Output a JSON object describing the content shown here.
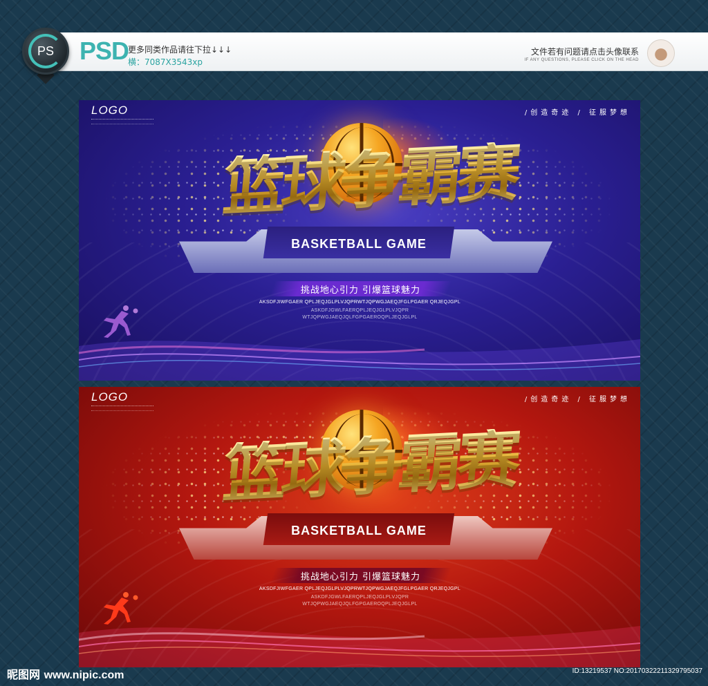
{
  "header": {
    "badge_label": "PS",
    "format_label": "PSD",
    "more_text": "更多同类作品请往下拉↓↓↓",
    "dimension_text": "横：7087X3543xp",
    "contact_text": "文件若有问题请点击头像联系",
    "contact_text_en": "IF ANY QUESTIONS, PLEASE CLICK ON THE HEAD"
  },
  "posters": [
    {
      "theme": "blue",
      "logo": "LOGO",
      "slogan": "/创造奇迹 / 征服梦想",
      "title": "篮球争霸赛",
      "subtitle_en": "BASKETBALL GAME",
      "tagline": "挑战地心引力 引爆篮球魅力",
      "filler_line1": "AKSDFJIWFGAER QPLJEQJGLPLVJQPRWTJQPWGJAEQJFGLPGAER QRJEQJGPL",
      "filler_line2": "ASKDFJGWLFAERQPLJEQJGLPLVJQPR WTJQPWGJAEQJQLFGPGAEROQPLJEQJGLPL"
    },
    {
      "theme": "red",
      "logo": "LOGO",
      "slogan": "/创造奇迹 / 征服梦想",
      "title": "篮球争霸赛",
      "subtitle_en": "BASKETBALL GAME",
      "tagline": "挑战地心引力 引爆篮球魅力",
      "filler_line1": "AKSDFJIWFGAER QPLJEQJGLPLVJQPRWTJQPWGJAEQJFGLPGAER QRJEQJGPL",
      "filler_line2": "ASKDFJGWLFAERQPLJEQJGLPLVJQPR WTJQPWGJAEQJQLFGPGAEROQPLJEQJGLPL"
    }
  ],
  "footer": {
    "site_name": "昵图网",
    "site_url": "www.nipic.com",
    "id_text": "ID:13219537 NO:20170322211329795037"
  },
  "colors": {
    "accent_teal": "#3db3b0",
    "blue_bg": "#2a1f92",
    "red_bg": "#b4170f",
    "gold": "#e9b63a"
  }
}
